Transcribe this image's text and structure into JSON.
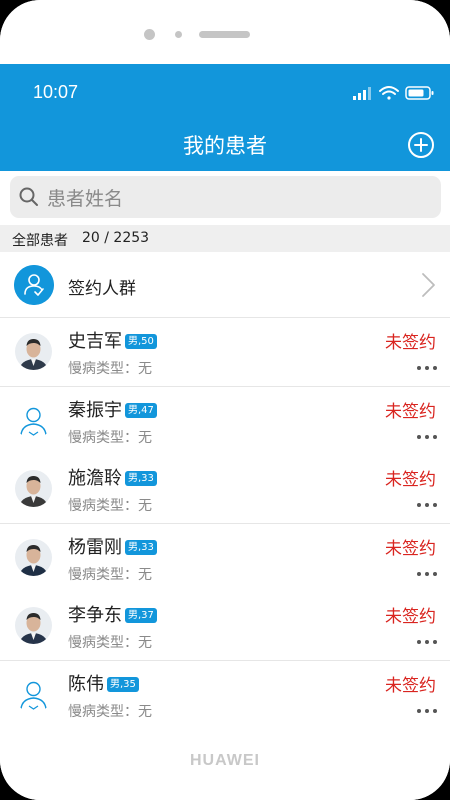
{
  "device": {
    "brand": "HUAWEI"
  },
  "status_bar": {
    "time": "10:07"
  },
  "header": {
    "title": "我的患者"
  },
  "search": {
    "placeholder": "患者姓名"
  },
  "summary": {
    "label": "全部患者",
    "count": "20 / 2253"
  },
  "sign_group": {
    "label": "签约人群"
  },
  "patients": [
    {
      "name": "史吉军",
      "badge": "男,50",
      "chronic": "慢病类型：无",
      "status": "未签约",
      "avatar": "photo"
    },
    {
      "name": "秦振宇",
      "badge": "男,47",
      "chronic": "慢病类型：无",
      "status": "未签约",
      "avatar": "placeholder"
    },
    {
      "name": "施澹聆",
      "badge": "男,33",
      "chronic": "慢病类型：无",
      "status": "未签约",
      "avatar": "photo"
    },
    {
      "name": "杨雷刚",
      "badge": "男,33",
      "chronic": "慢病类型：无",
      "status": "未签约",
      "avatar": "photo"
    },
    {
      "name": "李争东",
      "badge": "男,37",
      "chronic": "慢病类型：无",
      "status": "未签约",
      "avatar": "photo"
    },
    {
      "name": "陈伟",
      "badge": "男,35",
      "chronic": "慢病类型：无",
      "status": "未签约",
      "avatar": "placeholder"
    }
  ],
  "colors": {
    "primary": "#1296db",
    "status_red": "#d9241f",
    "muted": "#8a8a8a"
  }
}
